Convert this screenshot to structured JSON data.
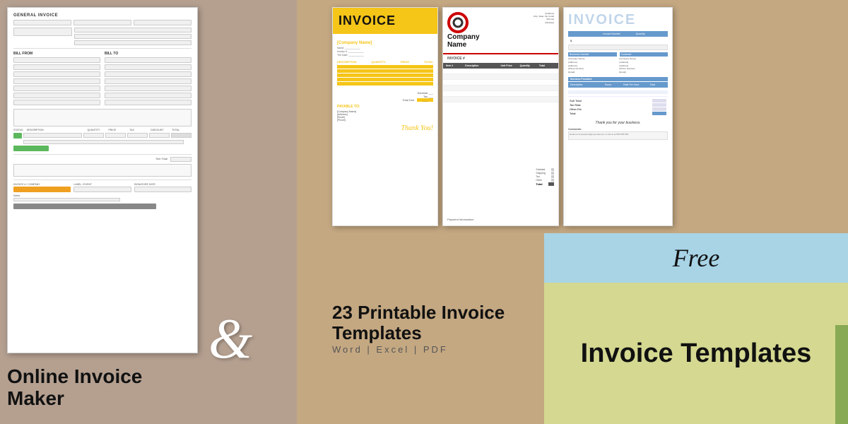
{
  "left": {
    "form": {
      "title": "GENERAL INVOICE",
      "bill_from": "BILL FROM",
      "bill_to": "BILL TO"
    },
    "bottom_title": "Online Invoice\nMaker"
  },
  "ampersand": "&",
  "templates": {
    "yellow": {
      "title": "INVOICE",
      "company": "[Company Name]",
      "info1": "Name:",
      "info2": "Invoice #:",
      "info3": "The Date:",
      "desc_header": [
        "DESCRIPTION",
        "QUANTITY",
        "PRICE",
        "TOTAL"
      ],
      "payable_to": "PAYABLE TO:",
      "company_lines": [
        "[Company Name]",
        "[Address]",
        "[Email]",
        "[Phone]"
      ],
      "thank_you": "Thank You!"
    },
    "company": {
      "company_name": "Company\nName",
      "invoice_label": "INVOICE #",
      "table_headers": [
        "Item #",
        "Description",
        "Unit Price",
        "Quantity",
        "Total"
      ],
      "totals": [
        "Subtotal",
        "Shipping",
        "Tax",
        "Other",
        "Total"
      ],
      "payment_info": "Payment Information:"
    },
    "blue": {
      "title": "INVOICE",
      "sections": [
        "Invoice Number",
        "Quantity"
      ],
      "dollar": "$",
      "bill_from": "Business Number",
      "bill_to": "Customer",
      "company_lines_from": [
        "[Company Name]",
        "[Address]",
        "[Email]",
        "[Phone Number]",
        "[Email]"
      ],
      "company_lines_to": [
        "[Company Name]",
        "[Address]",
        "[Email]",
        "[Phone Number]",
        "[Email]"
      ],
      "service_header": [
        "Description",
        "Hours",
        "Rate Per Hour",
        "Total"
      ],
      "thank_you": "Thank you for your business.",
      "comments": "Comments:"
    }
  },
  "main": {
    "title": "23 Printable Invoice Templates",
    "subtitle": "Word  |  Excel  |  PDF",
    "free": "Free",
    "invoice_templates": "Invoice Templates"
  }
}
